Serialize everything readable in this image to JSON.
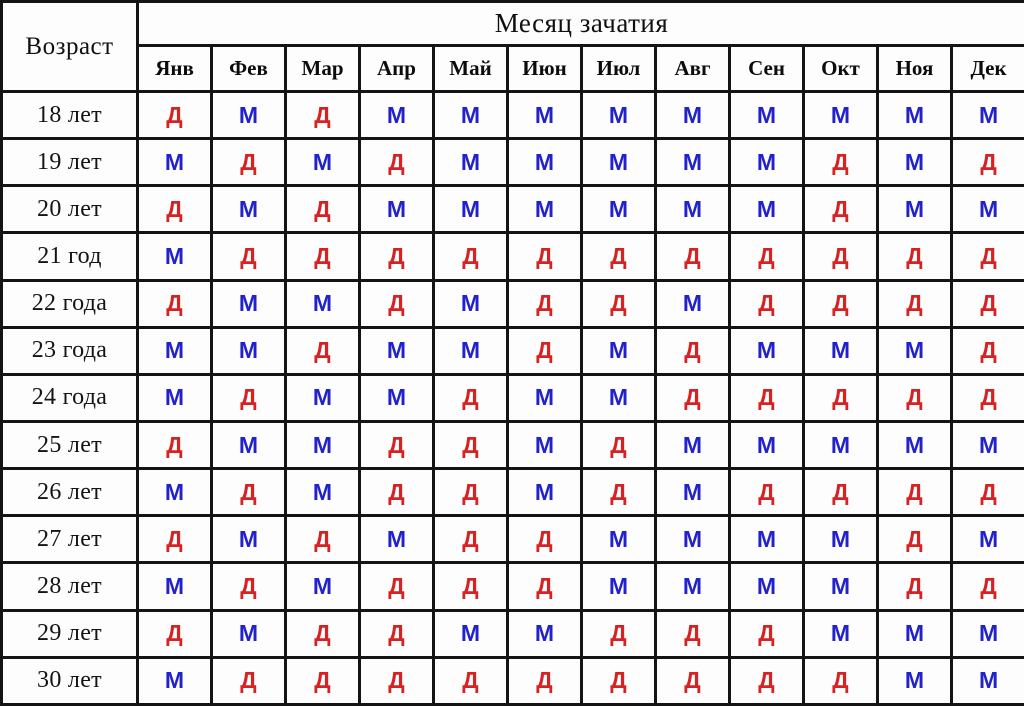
{
  "header": {
    "age_label": "Возраст",
    "conception_title": "Месяц зачатия",
    "months": [
      "Янв",
      "Фев",
      "Мар",
      "Апр",
      "Май",
      "Июн",
      "Июл",
      "Авг",
      "Сен",
      "Окт",
      "Ноя",
      "Дек"
    ]
  },
  "legend": {
    "boy_symbol": "М",
    "girl_symbol": "Д"
  },
  "colors": {
    "boy": "#2222cc",
    "girl": "#d62222",
    "age_cell_bg": "#f2dede",
    "month_head_bg": "#dce7ee",
    "cell_bg": "#fdfdfd",
    "grid_line": "#141414"
  },
  "chart_data": {
    "type": "table",
    "title": "Месяц зачатия",
    "xlabel": "Месяц зачатия",
    "ylabel": "Возраст",
    "categories": [
      "Янв",
      "Фев",
      "Мар",
      "Апр",
      "Май",
      "Июн",
      "Июл",
      "Авг",
      "Сен",
      "Окт",
      "Ноя",
      "Дек"
    ],
    "row_labels": [
      "18 лет",
      "19 лет",
      "20 лет",
      "21 год",
      "22 года",
      "23 года",
      "24 года",
      "25 лет",
      "26 лет",
      "27 лет",
      "28 лет",
      "29 лет",
      "30 лет"
    ],
    "values": [
      [
        "Д",
        "М",
        "Д",
        "М",
        "М",
        "М",
        "М",
        "М",
        "М",
        "М",
        "М",
        "М"
      ],
      [
        "М",
        "Д",
        "М",
        "Д",
        "М",
        "М",
        "М",
        "М",
        "М",
        "Д",
        "М",
        "Д"
      ],
      [
        "Д",
        "М",
        "Д",
        "М",
        "М",
        "М",
        "М",
        "М",
        "М",
        "Д",
        "М",
        "М"
      ],
      [
        "М",
        "Д",
        "Д",
        "Д",
        "Д",
        "Д",
        "Д",
        "Д",
        "Д",
        "Д",
        "Д",
        "Д"
      ],
      [
        "Д",
        "М",
        "М",
        "Д",
        "М",
        "Д",
        "Д",
        "М",
        "Д",
        "Д",
        "Д",
        "Д"
      ],
      [
        "М",
        "М",
        "Д",
        "М",
        "М",
        "Д",
        "М",
        "Д",
        "М",
        "М",
        "М",
        "Д"
      ],
      [
        "М",
        "Д",
        "М",
        "М",
        "Д",
        "М",
        "М",
        "Д",
        "Д",
        "Д",
        "Д",
        "Д"
      ],
      [
        "Д",
        "М",
        "М",
        "Д",
        "Д",
        "М",
        "Д",
        "М",
        "М",
        "М",
        "М",
        "М"
      ],
      [
        "М",
        "Д",
        "М",
        "Д",
        "Д",
        "М",
        "Д",
        "М",
        "Д",
        "Д",
        "Д",
        "Д"
      ],
      [
        "Д",
        "М",
        "Д",
        "М",
        "Д",
        "Д",
        "М",
        "М",
        "М",
        "М",
        "Д",
        "М"
      ],
      [
        "М",
        "Д",
        "М",
        "Д",
        "Д",
        "Д",
        "М",
        "М",
        "М",
        "М",
        "Д",
        "Д"
      ],
      [
        "Д",
        "М",
        "Д",
        "Д",
        "М",
        "М",
        "Д",
        "Д",
        "Д",
        "М",
        "М",
        "М"
      ],
      [
        "М",
        "Д",
        "Д",
        "Д",
        "Д",
        "Д",
        "Д",
        "Д",
        "Д",
        "Д",
        "М",
        "М"
      ]
    ]
  },
  "rows": [
    {
      "age": "18 лет",
      "cells": [
        "Д",
        "М",
        "Д",
        "М",
        "М",
        "М",
        "М",
        "М",
        "М",
        "М",
        "М",
        "М"
      ]
    },
    {
      "age": "19 лет",
      "cells": [
        "М",
        "Д",
        "М",
        "Д",
        "М",
        "М",
        "М",
        "М",
        "М",
        "Д",
        "М",
        "Д"
      ]
    },
    {
      "age": "20 лет",
      "cells": [
        "Д",
        "М",
        "Д",
        "М",
        "М",
        "М",
        "М",
        "М",
        "М",
        "Д",
        "М",
        "М"
      ]
    },
    {
      "age": "21 год",
      "cells": [
        "М",
        "Д",
        "Д",
        "Д",
        "Д",
        "Д",
        "Д",
        "Д",
        "Д",
        "Д",
        "Д",
        "Д"
      ]
    },
    {
      "age": "22 года",
      "cells": [
        "Д",
        "М",
        "М",
        "Д",
        "М",
        "Д",
        "Д",
        "М",
        "Д",
        "Д",
        "Д",
        "Д"
      ]
    },
    {
      "age": "23 года",
      "cells": [
        "М",
        "М",
        "Д",
        "М",
        "М",
        "Д",
        "М",
        "Д",
        "М",
        "М",
        "М",
        "Д"
      ]
    },
    {
      "age": "24 года",
      "cells": [
        "М",
        "Д",
        "М",
        "М",
        "Д",
        "М",
        "М",
        "Д",
        "Д",
        "Д",
        "Д",
        "Д"
      ]
    },
    {
      "age": "25 лет",
      "cells": [
        "Д",
        "М",
        "М",
        "Д",
        "Д",
        "М",
        "Д",
        "М",
        "М",
        "М",
        "М",
        "М"
      ]
    },
    {
      "age": "26 лет",
      "cells": [
        "М",
        "Д",
        "М",
        "Д",
        "Д",
        "М",
        "Д",
        "М",
        "Д",
        "Д",
        "Д",
        "Д"
      ]
    },
    {
      "age": "27 лет",
      "cells": [
        "Д",
        "М",
        "Д",
        "М",
        "Д",
        "Д",
        "М",
        "М",
        "М",
        "М",
        "Д",
        "М"
      ]
    },
    {
      "age": "28 лет",
      "cells": [
        "М",
        "Д",
        "М",
        "Д",
        "Д",
        "Д",
        "М",
        "М",
        "М",
        "М",
        "Д",
        "Д"
      ]
    },
    {
      "age": "29 лет",
      "cells": [
        "Д",
        "М",
        "Д",
        "Д",
        "М",
        "М",
        "Д",
        "Д",
        "Д",
        "М",
        "М",
        "М"
      ]
    },
    {
      "age": "30 лет",
      "cells": [
        "М",
        "Д",
        "Д",
        "Д",
        "Д",
        "Д",
        "Д",
        "Д",
        "Д",
        "Д",
        "М",
        "М"
      ]
    }
  ]
}
